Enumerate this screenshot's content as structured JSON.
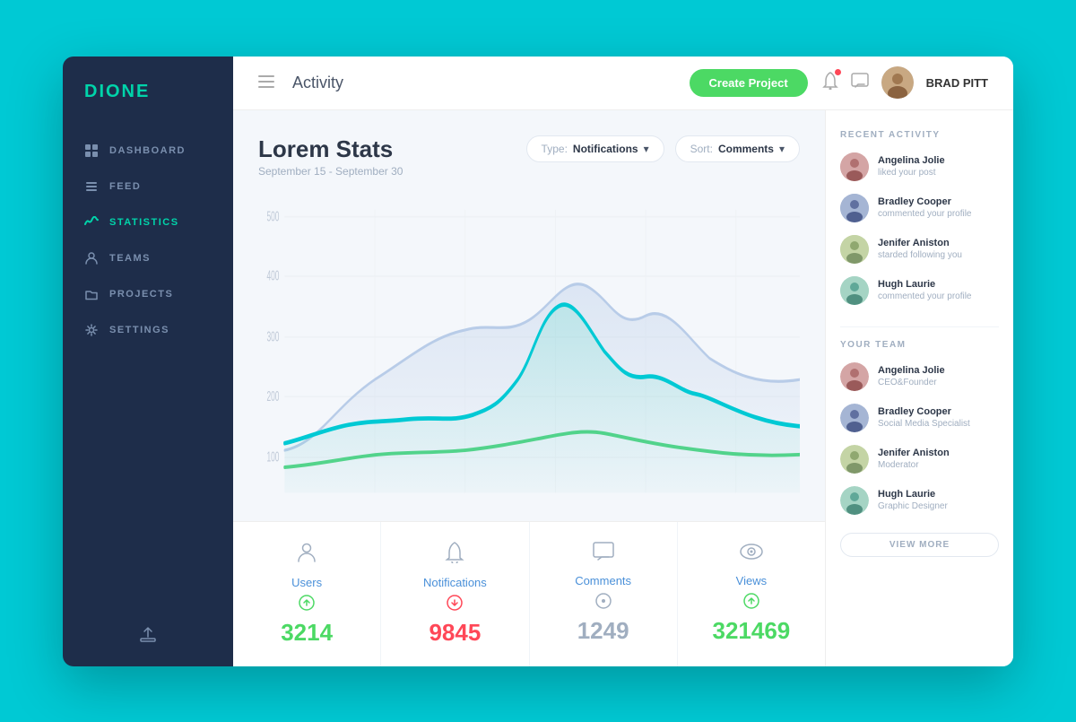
{
  "sidebar": {
    "logo_prefix": "DI",
    "logo_accent": "ONE",
    "nav_items": [
      {
        "id": "dashboard",
        "label": "DASHBOARD",
        "icon": "grid",
        "active": false
      },
      {
        "id": "feed",
        "label": "FEED",
        "icon": "layers",
        "active": false
      },
      {
        "id": "statistics",
        "label": "STATISTICS",
        "icon": "chart",
        "active": true
      },
      {
        "id": "teams",
        "label": "TEAMS",
        "icon": "person",
        "active": false
      },
      {
        "id": "projects",
        "label": "PROJECTS",
        "icon": "folder",
        "active": false
      },
      {
        "id": "settings",
        "label": "SETTINGS",
        "icon": "gear",
        "active": false
      }
    ]
  },
  "header": {
    "title": "Activity",
    "create_btn": "Create Project",
    "username": "BRAD PITT"
  },
  "chart_section": {
    "title": "Lorem Stats",
    "subtitle": "September 15 - September 30",
    "filter_type_label": "Type:",
    "filter_type_value": "Notifications",
    "filter_sort_label": "Sort:",
    "filter_sort_value": "Comments",
    "y_labels": [
      "500",
      "400",
      "300",
      "200",
      "100"
    ]
  },
  "stats": [
    {
      "id": "users",
      "icon": "person",
      "label": "Users",
      "trend": "up",
      "value": "3214",
      "color": "green"
    },
    {
      "id": "notifications",
      "icon": "bell",
      "label": "Notifications",
      "trend": "down",
      "value": "9845",
      "color": "red"
    },
    {
      "id": "comments",
      "icon": "comment",
      "label": "Comments",
      "trend": "neutral",
      "value": "1249",
      "color": "gray"
    },
    {
      "id": "views",
      "icon": "eye",
      "label": "Views",
      "trend": "up",
      "value": "321469",
      "color": "green"
    }
  ],
  "recent_activity": {
    "section_title": "RECENT ACTIVITY",
    "items": [
      {
        "name": "Angelina Jolie",
        "action": "liked your post",
        "avatar_id": "angelina"
      },
      {
        "name": "Bradley Cooper",
        "action": "commented your profile",
        "avatar_id": "bradley"
      },
      {
        "name": "Jenifer Aniston",
        "action": "starded following you",
        "avatar_id": "jenifer"
      },
      {
        "name": "Hugh Laurie",
        "action": "commented your profile",
        "avatar_id": "hugh"
      }
    ]
  },
  "your_team": {
    "section_title": "YOUR TEAM",
    "items": [
      {
        "name": "Angelina Jolie",
        "role": "CEO&Founder",
        "avatar_id": "angelina"
      },
      {
        "name": "Bradley Cooper",
        "role": "Social Media Specialist",
        "avatar_id": "bradley"
      },
      {
        "name": "Jenifer Aniston",
        "role": "Moderator",
        "avatar_id": "jenifer"
      },
      {
        "name": "Hugh Laurie",
        "role": "Graphic Designer",
        "avatar_id": "hugh"
      }
    ],
    "view_more": "VIEW MORE"
  },
  "colors": {
    "accent_teal": "#00d4aa",
    "accent_blue": "#00b4cc",
    "sidebar_bg": "#1e2d4a",
    "green": "#4cd964",
    "red": "#ff4757"
  }
}
